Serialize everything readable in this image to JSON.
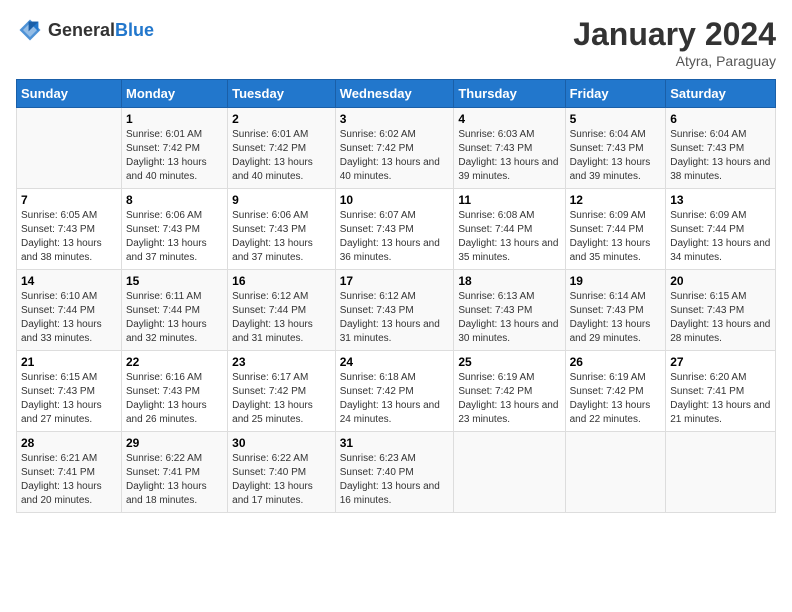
{
  "header": {
    "logo_general": "General",
    "logo_blue": "Blue",
    "month_year": "January 2024",
    "location": "Atyra, Paraguay"
  },
  "days_of_week": [
    "Sunday",
    "Monday",
    "Tuesday",
    "Wednesday",
    "Thursday",
    "Friday",
    "Saturday"
  ],
  "weeks": [
    [
      {
        "day": "",
        "sunrise": "",
        "sunset": "",
        "daylight": ""
      },
      {
        "day": "1",
        "sunrise": "Sunrise: 6:01 AM",
        "sunset": "Sunset: 7:42 PM",
        "daylight": "Daylight: 13 hours and 40 minutes."
      },
      {
        "day": "2",
        "sunrise": "Sunrise: 6:01 AM",
        "sunset": "Sunset: 7:42 PM",
        "daylight": "Daylight: 13 hours and 40 minutes."
      },
      {
        "day": "3",
        "sunrise": "Sunrise: 6:02 AM",
        "sunset": "Sunset: 7:42 PM",
        "daylight": "Daylight: 13 hours and 40 minutes."
      },
      {
        "day": "4",
        "sunrise": "Sunrise: 6:03 AM",
        "sunset": "Sunset: 7:43 PM",
        "daylight": "Daylight: 13 hours and 39 minutes."
      },
      {
        "day": "5",
        "sunrise": "Sunrise: 6:04 AM",
        "sunset": "Sunset: 7:43 PM",
        "daylight": "Daylight: 13 hours and 39 minutes."
      },
      {
        "day": "6",
        "sunrise": "Sunrise: 6:04 AM",
        "sunset": "Sunset: 7:43 PM",
        "daylight": "Daylight: 13 hours and 38 minutes."
      }
    ],
    [
      {
        "day": "7",
        "sunrise": "Sunrise: 6:05 AM",
        "sunset": "Sunset: 7:43 PM",
        "daylight": "Daylight: 13 hours and 38 minutes."
      },
      {
        "day": "8",
        "sunrise": "Sunrise: 6:06 AM",
        "sunset": "Sunset: 7:43 PM",
        "daylight": "Daylight: 13 hours and 37 minutes."
      },
      {
        "day": "9",
        "sunrise": "Sunrise: 6:06 AM",
        "sunset": "Sunset: 7:43 PM",
        "daylight": "Daylight: 13 hours and 37 minutes."
      },
      {
        "day": "10",
        "sunrise": "Sunrise: 6:07 AM",
        "sunset": "Sunset: 7:43 PM",
        "daylight": "Daylight: 13 hours and 36 minutes."
      },
      {
        "day": "11",
        "sunrise": "Sunrise: 6:08 AM",
        "sunset": "Sunset: 7:44 PM",
        "daylight": "Daylight: 13 hours and 35 minutes."
      },
      {
        "day": "12",
        "sunrise": "Sunrise: 6:09 AM",
        "sunset": "Sunset: 7:44 PM",
        "daylight": "Daylight: 13 hours and 35 minutes."
      },
      {
        "day": "13",
        "sunrise": "Sunrise: 6:09 AM",
        "sunset": "Sunset: 7:44 PM",
        "daylight": "Daylight: 13 hours and 34 minutes."
      }
    ],
    [
      {
        "day": "14",
        "sunrise": "Sunrise: 6:10 AM",
        "sunset": "Sunset: 7:44 PM",
        "daylight": "Daylight: 13 hours and 33 minutes."
      },
      {
        "day": "15",
        "sunrise": "Sunrise: 6:11 AM",
        "sunset": "Sunset: 7:44 PM",
        "daylight": "Daylight: 13 hours and 32 minutes."
      },
      {
        "day": "16",
        "sunrise": "Sunrise: 6:12 AM",
        "sunset": "Sunset: 7:44 PM",
        "daylight": "Daylight: 13 hours and 31 minutes."
      },
      {
        "day": "17",
        "sunrise": "Sunrise: 6:12 AM",
        "sunset": "Sunset: 7:43 PM",
        "daylight": "Daylight: 13 hours and 31 minutes."
      },
      {
        "day": "18",
        "sunrise": "Sunrise: 6:13 AM",
        "sunset": "Sunset: 7:43 PM",
        "daylight": "Daylight: 13 hours and 30 minutes."
      },
      {
        "day": "19",
        "sunrise": "Sunrise: 6:14 AM",
        "sunset": "Sunset: 7:43 PM",
        "daylight": "Daylight: 13 hours and 29 minutes."
      },
      {
        "day": "20",
        "sunrise": "Sunrise: 6:15 AM",
        "sunset": "Sunset: 7:43 PM",
        "daylight": "Daylight: 13 hours and 28 minutes."
      }
    ],
    [
      {
        "day": "21",
        "sunrise": "Sunrise: 6:15 AM",
        "sunset": "Sunset: 7:43 PM",
        "daylight": "Daylight: 13 hours and 27 minutes."
      },
      {
        "day": "22",
        "sunrise": "Sunrise: 6:16 AM",
        "sunset": "Sunset: 7:43 PM",
        "daylight": "Daylight: 13 hours and 26 minutes."
      },
      {
        "day": "23",
        "sunrise": "Sunrise: 6:17 AM",
        "sunset": "Sunset: 7:42 PM",
        "daylight": "Daylight: 13 hours and 25 minutes."
      },
      {
        "day": "24",
        "sunrise": "Sunrise: 6:18 AM",
        "sunset": "Sunset: 7:42 PM",
        "daylight": "Daylight: 13 hours and 24 minutes."
      },
      {
        "day": "25",
        "sunrise": "Sunrise: 6:19 AM",
        "sunset": "Sunset: 7:42 PM",
        "daylight": "Daylight: 13 hours and 23 minutes."
      },
      {
        "day": "26",
        "sunrise": "Sunrise: 6:19 AM",
        "sunset": "Sunset: 7:42 PM",
        "daylight": "Daylight: 13 hours and 22 minutes."
      },
      {
        "day": "27",
        "sunrise": "Sunrise: 6:20 AM",
        "sunset": "Sunset: 7:41 PM",
        "daylight": "Daylight: 13 hours and 21 minutes."
      }
    ],
    [
      {
        "day": "28",
        "sunrise": "Sunrise: 6:21 AM",
        "sunset": "Sunset: 7:41 PM",
        "daylight": "Daylight: 13 hours and 20 minutes."
      },
      {
        "day": "29",
        "sunrise": "Sunrise: 6:22 AM",
        "sunset": "Sunset: 7:41 PM",
        "daylight": "Daylight: 13 hours and 18 minutes."
      },
      {
        "day": "30",
        "sunrise": "Sunrise: 6:22 AM",
        "sunset": "Sunset: 7:40 PM",
        "daylight": "Daylight: 13 hours and 17 minutes."
      },
      {
        "day": "31",
        "sunrise": "Sunrise: 6:23 AM",
        "sunset": "Sunset: 7:40 PM",
        "daylight": "Daylight: 13 hours and 16 minutes."
      },
      {
        "day": "",
        "sunrise": "",
        "sunset": "",
        "daylight": ""
      },
      {
        "day": "",
        "sunrise": "",
        "sunset": "",
        "daylight": ""
      },
      {
        "day": "",
        "sunrise": "",
        "sunset": "",
        "daylight": ""
      }
    ]
  ]
}
